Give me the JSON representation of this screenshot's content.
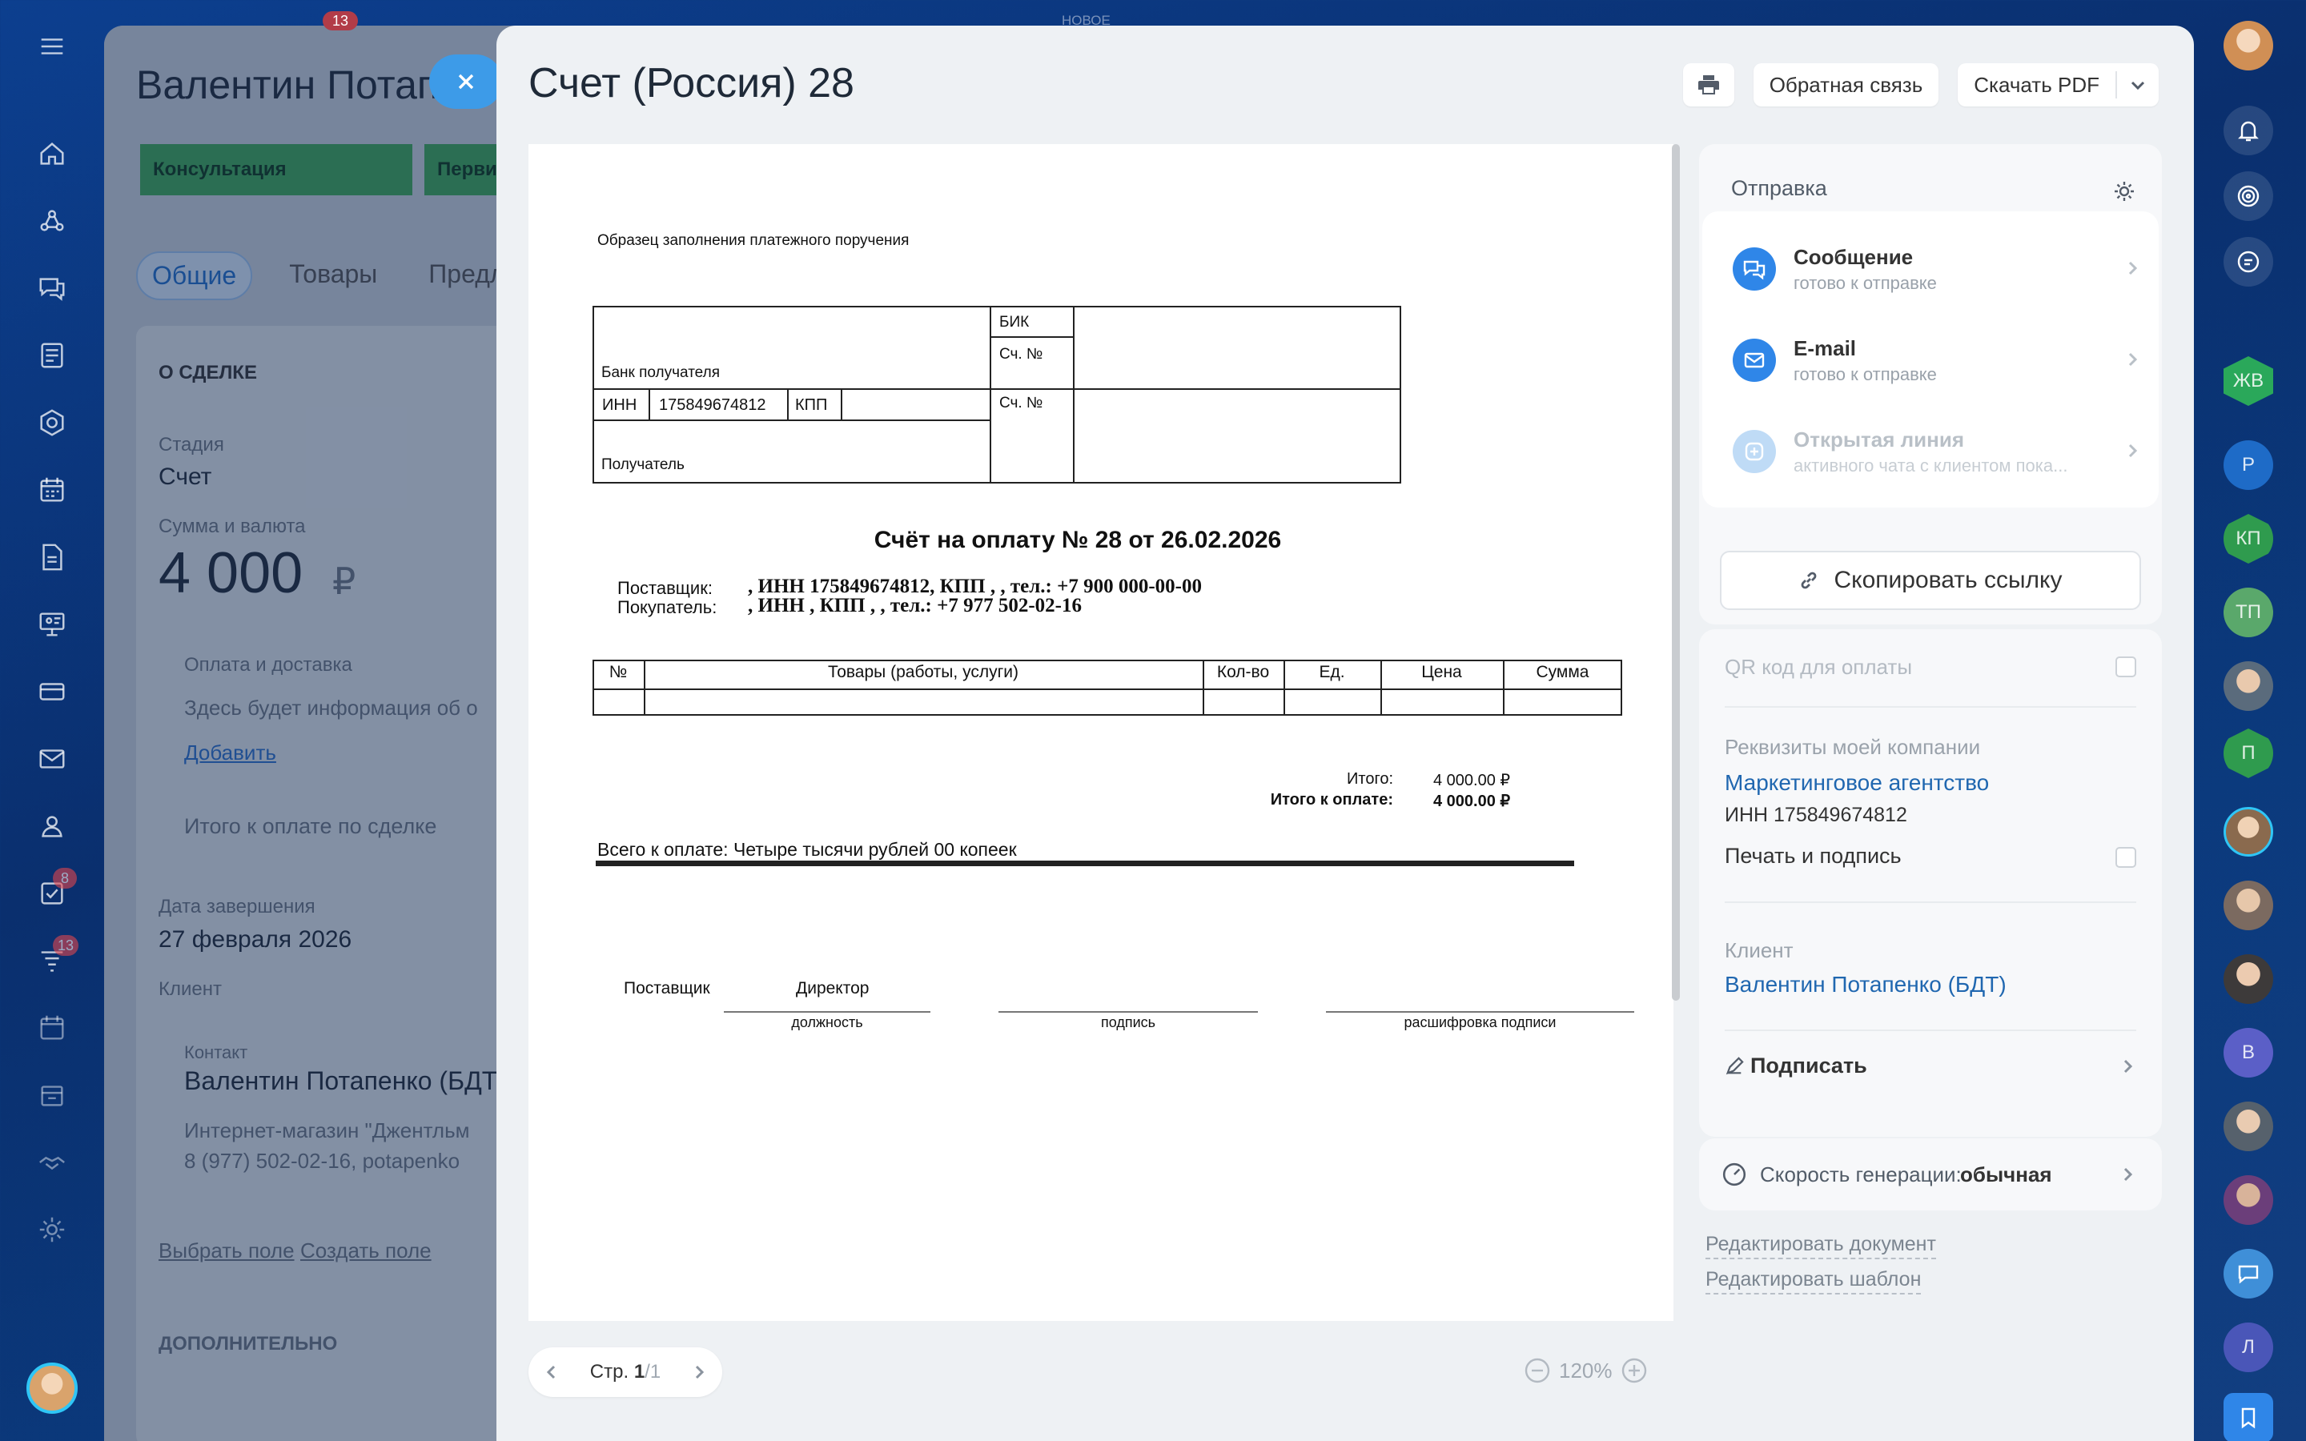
{
  "background_deal": {
    "title": "Валентин Потап",
    "stages": [
      "Консультация",
      "Перви"
    ],
    "tabs": [
      "Общие",
      "Товары",
      "Предлож"
    ],
    "section": "О СДЕЛКЕ",
    "stage_label": "Стадия",
    "stage_value": "Счет",
    "sum_label": "Сумма и валюта",
    "sum_value": "4 000",
    "currency": "₽",
    "payment_label": "Оплата и доставка",
    "payment_text": "Здесь будет информация об о",
    "add_link": "Добавить",
    "total_label": "Итого к оплате по сделке",
    "end_label": "Дата завершения",
    "end_value": "27 февраля 2026",
    "client_label": "Клиент",
    "contact_label": "Контакт",
    "contact_name": "Валентин Потапенко (БДТ",
    "contact_company": "Интернет-магазин \"Джентльм",
    "contact_phone": "8 (977) 502-02-16, potapenko",
    "field_link_1": "Выбрать поле",
    "field_link_2": "Создать поле",
    "additional": "ДОПОЛНИТЕЛЬНО",
    "new_badge": "НОВОЕ",
    "top_badge": "13",
    "nav_badge_tasks": "8",
    "nav_badge_crm": "13"
  },
  "slider": {
    "title": "Счет (Россия) 28",
    "feedback_label": "Обратная связь",
    "download_label": "Скачать PDF"
  },
  "document": {
    "sample_title": "Образец заполнения платежного поручения",
    "bank_label": "Банк получателя",
    "bik_label": "БИК",
    "account_label": "Сч. №",
    "account_label_2": "Сч. №",
    "inn_label": "ИНН",
    "inn_value": "175849674812",
    "kpp_label": "КПП",
    "recipient_label": "Получатель",
    "invoice_title": "Счёт на оплату № 28 от 26.02.2026",
    "supplier_label": "Поставщик:",
    "supplier_value": ", ИНН 175849674812, КПП , , тел.: +7 900 000-00-00",
    "buyer_label": "Покупатель:",
    "buyer_value": ", ИНН , КПП , , тел.: +7 977 502-02-16",
    "columns": [
      "№",
      "Товары (работы, услуги)",
      "Кол-во",
      "Ед.",
      "Цена",
      "Сумма"
    ],
    "total_label": "Итого:",
    "total_value": "4 000.00 ₽",
    "to_pay_label": "Итого к оплате:",
    "to_pay_value": "4 000.00 ₽",
    "in_words": "Всего к оплате: Четыре тысячи рублей 00 копеек",
    "sign_supplier": "Поставщик",
    "sign_position_value": "Директор",
    "sign_position": "должность",
    "sign_signature": "подпись",
    "sign_decode": "расшифровка подписи"
  },
  "pager": {
    "page_prefix": "Стр.",
    "current": "1",
    "total": "/1",
    "zoom": "120%"
  },
  "sending": {
    "title": "Отправка",
    "channels": [
      {
        "title": "Сообщение",
        "subtitle": "готово к отправке"
      },
      {
        "title": "E-mail",
        "subtitle": "готово к отправке"
      },
      {
        "title": "Открытая линия",
        "subtitle": "активного чата с клиентом пока..."
      }
    ],
    "copy_link": "Скопировать ссылку"
  },
  "settings": {
    "qr_label": "QR код для оплаты",
    "requisites_label": "Реквизиты моей компании",
    "company_name": "Маркетинговое агентство",
    "company_inn": "ИНН 175849674812",
    "print_sign": "Печать и подпись",
    "client_label": "Клиент",
    "client_name": "Валентин Потапенко (БДТ)",
    "sign_action": "Подписать"
  },
  "generation": {
    "label": "Скорость генерации:",
    "value": "обычная"
  },
  "footer_links": {
    "edit_document": "Редактировать документ",
    "edit_template": "Редактировать шаблон"
  },
  "right_rail": {
    "avatars": [
      "ЖВ",
      "Р",
      "КП",
      "ТП",
      "П",
      "В",
      "Л"
    ]
  },
  "colors": {
    "accent": "#2f86e8",
    "link": "#2067b0",
    "stage_green": "#3fa857",
    "background": "#0c3f8f"
  }
}
